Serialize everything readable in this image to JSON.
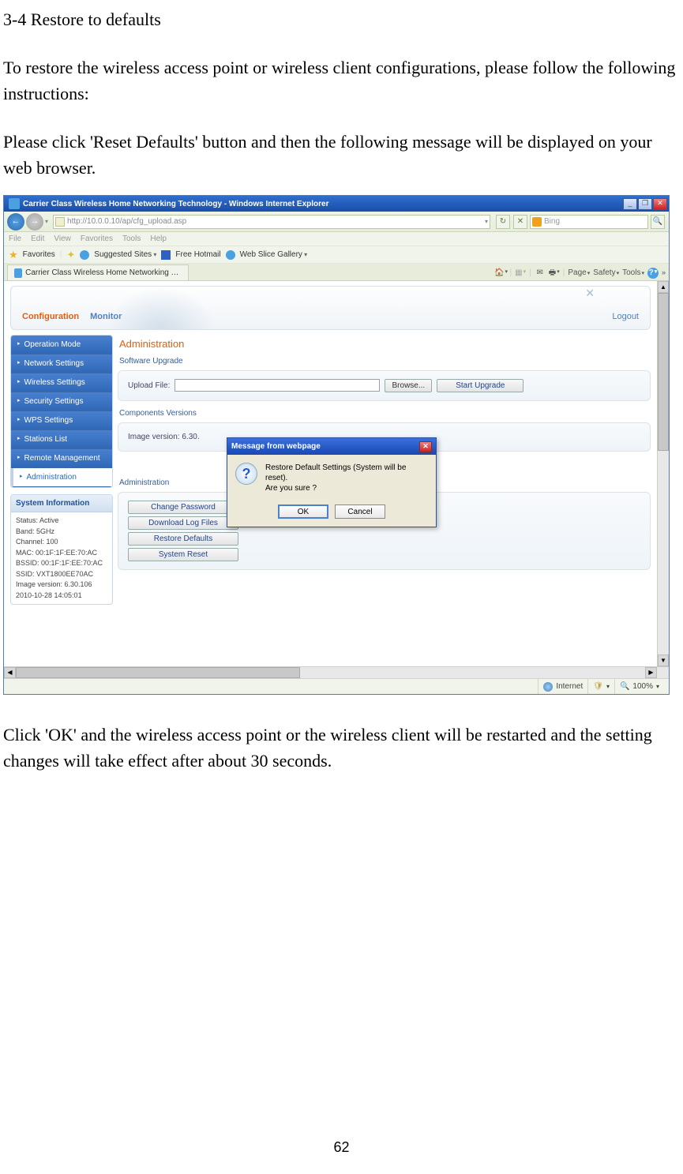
{
  "doc": {
    "heading": "3-4 Restore to defaults",
    "para1": "To restore the wireless access point or wireless client configurations, please follow the following instructions:",
    "para2": "Please click 'Reset Defaults' button and then the following message will be displayed on your web browser.",
    "para3": "Click 'OK' and the wireless access point or the wireless client will be restarted and the setting changes will take effect after about 30 seconds.",
    "page_number": "62"
  },
  "ie": {
    "title": "Carrier Class Wireless Home Networking Technology - Windows Internet Explorer",
    "url": "http://10.0.0.10/ap/cfg_upload.asp",
    "search_provider": "Bing",
    "menu": {
      "file": "File",
      "edit": "Edit",
      "view": "View",
      "favorites": "Favorites",
      "tools": "Tools",
      "help": "Help"
    },
    "fav": {
      "label": "Favorites",
      "suggested": "Suggested Sites",
      "hotmail": "Free Hotmail",
      "slice": "Web Slice Gallery"
    },
    "tab_title": "Carrier Class Wireless Home Networking Technology",
    "tbr": {
      "page": "Page",
      "safety": "Safety",
      "tools": "Tools"
    },
    "status": {
      "zone": "Internet",
      "zoom": "100%"
    }
  },
  "router": {
    "tabs": {
      "config": "Configuration",
      "monitor": "Monitor"
    },
    "logout": "Logout",
    "menu": [
      "Operation Mode",
      "Network Settings",
      "Wireless Settings",
      "Security Settings",
      "WPS Settings",
      "Stations List",
      "Remote Management",
      "Administration"
    ],
    "info": {
      "title": "System Information",
      "status": "Status: Active",
      "band": "Band: 5GHz",
      "channel": "Channel: 100",
      "mac": "MAC: 00:1F:1F:EE:70:AC",
      "bssid": "BSSID: 00:1F:1F:EE:70:AC",
      "ssid": "SSID: VXT1800EE70AC",
      "image": "Image version: 6.30.106",
      "date": "2010-10-28 14:05:01"
    },
    "admin": {
      "title": "Administration",
      "sw": "Software Upgrade",
      "upload_label": "Upload File:",
      "browse": "Browse...",
      "start": "Start Upgrade",
      "comp": "Components Versions",
      "imgver": "Image version: 6.30.",
      "admin2": "Administration",
      "b1": "Change Password",
      "b2": "Download Log Files",
      "b3": "Restore Defaults",
      "b4": "System Reset"
    }
  },
  "dialog": {
    "title": "Message from webpage",
    "line1": "Restore Default Settings (System will be reset).",
    "line2": "Are you sure ?",
    "ok": "OK",
    "cancel": "Cancel"
  }
}
